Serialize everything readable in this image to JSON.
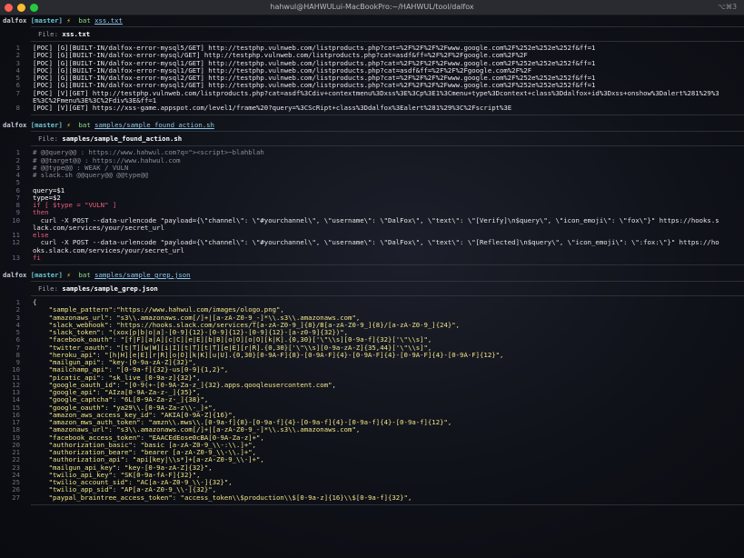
{
  "window": {
    "title": "hahwul@HAHWULui-MacBookPro:~/HAHWUL/tool/dalfox",
    "shortcut": "⌥⌘3"
  },
  "prompt": {
    "host": "dalfox",
    "branch": "[master]",
    "bolt": "⚡"
  },
  "labels": {
    "file": "File: "
  },
  "blocks": [
    {
      "cmd": "bat",
      "arg": "xss.txt",
      "file": "xss.txt",
      "lines": [
        {
          "n": "1",
          "t": "[POC] [G][BUILT-IN/dalfox-error-mysql5/GET] http://testphp.vulnweb.com/listproducts.php?cat=%2F%2F%2F%2Fwww.google.com%2F%252e%252e%252f&ff=1"
        },
        {
          "n": "2",
          "t": "[POC] [G][BUILT-IN/dalfox-error-mysql/GET] http://testphp.vulnweb.com/listproducts.php?cat=asdf&ff=%2F%2F%2Fgoogle.com%2F%2F"
        },
        {
          "n": "3",
          "t": "[POC] [G][BUILT-IN/dalfox-error-mysql1/GET] http://testphp.vulnweb.com/listproducts.php?cat=%2F%2F%2F%2Fwww.google.com%2F%252e%252e%252f&ff=1"
        },
        {
          "n": "4",
          "t": "[POC] [G][BUILT-IN/dalfox-error-mysql1/GET] http://testphp.vulnweb.com/listproducts.php?cat=asdf&ff=%2F%2F%2Fgoogle.com%2F%2F"
        },
        {
          "n": "5",
          "t": "[POC] [G][BUILT-IN/dalfox-error-mysql2/GET] http://testphp.vulnweb.com/listproducts.php?cat=%2F%2F%2F%2Fwww.google.com%2F%252e%252e%252f&ff=1"
        },
        {
          "n": "6",
          "t": "[POC] [G][BUILT-IN/dalfox-error-mysql1/GET] http://testphp.vulnweb.com/listproducts.php?cat=%2F%2F%2F%2Fwww.google.com%2F%252e%252e%252f&ff=1"
        },
        {
          "n": "7",
          "t": "[POC] [V][GET] http://testphp.vulnweb.com/listproducts.php?cat=asdf%3Cdiv+contextmenu%3Dxss%3E%3Cp%3E1%3Cmenu+type%3Dcontext+class%3Ddalfox+id%3Dxss+onshow%3Dalert%281%29%3"
        },
        {
          "n": "",
          "t": "E%3C%2Fmenu%3E%3C%2Fdiv%3E&ff=1"
        },
        {
          "n": "8",
          "t": "[POC] [V][GET] https://xss-game.appspot.com/level1/frame%20?query=%3CScRipt+class%3Ddalfox%3Ealert%281%29%3C%2Fscript%3E"
        }
      ]
    },
    {
      "cmd": "bat",
      "arg": "samples/sample_found_action.sh",
      "file": "samples/sample_found_action.sh",
      "lines": [
        {
          "n": "1",
          "t": "# @@query@@ : https://www.hahwul.com?q=\"><script>~blahblah",
          "c": "c-comment"
        },
        {
          "n": "2",
          "t": "# @@target@@ : https://www.hahwul.com",
          "c": "c-comment"
        },
        {
          "n": "3",
          "t": "# @@type@@ : WEAK / VULN",
          "c": "c-comment"
        },
        {
          "n": "4",
          "t": "# slack.sh @@query@@ @@type@@",
          "c": "c-comment"
        },
        {
          "n": "5",
          "t": ""
        },
        {
          "n": "6",
          "t": "query=$1",
          "c": "c-var"
        },
        {
          "n": "7",
          "t": "type=$2",
          "c": "c-var"
        },
        {
          "n": "8",
          "t": "if [ $type = \"VULN\" ]",
          "c": "c-kw"
        },
        {
          "n": "9",
          "t": "then",
          "c": "c-kw"
        },
        {
          "n": "10",
          "t": "  curl -X POST --data-urlencode \"payload={\\\"channel\\\": \\\"#yourchannel\\\", \\\"username\\\": \\\"DalFox\\\", \\\"text\\\": \\\"[Verify]\\n$query\\\", \\\"icon_emoji\\\": \\\"fox\\\"}\" https://hooks.s"
        },
        {
          "n": "",
          "t": "lack.com/services/your/secret_url"
        },
        {
          "n": "11",
          "t": "else",
          "c": "c-kw"
        },
        {
          "n": "12",
          "t": "  curl -X POST --data-urlencode \"payload={\\\"channel\\\": \\\"#yourchannel\\\", \\\"username\\\": \\\"DalFox\\\", \\\"text\\\": \\\"[Reflected]\\n$query\\\", \\\"icon_emoji\\\": \\\":fox:\\\"}\" https://ho"
        },
        {
          "n": "",
          "t": "oks.slack.com/services/your/secret_url"
        },
        {
          "n": "13",
          "t": "fi",
          "c": "c-kw"
        }
      ]
    },
    {
      "cmd": "bat",
      "arg": "samples/sample_grep.json",
      "file": "samples/sample_grep.json",
      "lines": [
        {
          "n": "1",
          "t": "{"
        },
        {
          "n": "2",
          "t": "    \"sample_pattern\":\"https://www.hahwul.com/images/ologo.png\",",
          "c": "c-key"
        },
        {
          "n": "3",
          "t": "    \"amazonaws_url\": \"s3\\\\.amazonaws.com[/]+|[a-zA-Z0-9_-]*\\\\.s3\\\\.amazonaws.com\",",
          "c": "c-key"
        },
        {
          "n": "4",
          "t": "    \"slack_webhook\": \"https://hooks.slack.com/services/T[a-zA-Z0-9_]{8}/B[a-zA-Z0-9_]{8}/[a-zA-Z0-9_]{24}\",",
          "c": "c-key"
        },
        {
          "n": "5",
          "t": "    \"slack_token\": \"(xox[p|b|o|a]-[0-9]{12}-[0-9]{12}-[0-9]{12}-[a-z0-9]{32})\",",
          "c": "c-key"
        },
        {
          "n": "6",
          "t": "    \"facebook_oauth\": \"[f|F][a|A][c|C][e|E][b|B][o|O][o|O][k|K].{0,30}['\\\"\\\\s][0-9a-f]{32}['\\\"\\\\s]\",",
          "c": "c-key"
        },
        {
          "n": "7",
          "t": "    \"twitter_oauth\": \"[t|T][w|W][i|I][t|T][t|T][e|E][r|R].{0,30}['\\\"\\\\s][0-9a-zA-Z]{35,44}['\\\"\\\\s]\",",
          "c": "c-key"
        },
        {
          "n": "8",
          "t": "    \"heroku_api\": \"[h|H][e|E][r|R][o|O][k|K][u|U].{0,30}[0-9A-F]{8}-[0-9A-F]{4}-[0-9A-F]{4}-[0-9A-F]{4}-[0-9A-F]{12}\",",
          "c": "c-key"
        },
        {
          "n": "9",
          "t": "    \"mailgun_api\": \"key-[0-9a-zA-Z]{32}\",",
          "c": "c-key"
        },
        {
          "n": "10",
          "t": "    \"mailchamp_api\": \"[0-9a-f]{32}-us[0-9]{1,2}\",",
          "c": "c-key"
        },
        {
          "n": "11",
          "t": "    \"picatic_api\": \"sk_live_[0-9a-z]{32}\",",
          "c": "c-key"
        },
        {
          "n": "12",
          "t": "    \"google_oauth_id\": \"[0-9(+-[0-9A-Za-z_]{32}.apps.qooqleusercontent.com\",",
          "c": "c-key"
        },
        {
          "n": "13",
          "t": "    \"google_api\": \"AIza[0-9A-Za-z-_]{35}\",",
          "c": "c-key"
        },
        {
          "n": "14",
          "t": "    \"google_captcha\": \"6L[0-9A-Za-z-_]{38}\",",
          "c": "c-key"
        },
        {
          "n": "15",
          "t": "    \"google_oauth\": \"ya29\\\\.[0-9A-Za-z\\\\-_]+\",",
          "c": "c-key"
        },
        {
          "n": "16",
          "t": "    \"amazon_aws_access_key_id\": \"AKIA[0-9A-Z]{16}\",",
          "c": "c-key"
        },
        {
          "n": "17",
          "t": "    \"amazon_mws_auth_token\": \"amzn\\\\.mws\\\\.[0-9a-f]{8}-[0-9a-f]{4}-[0-9a-f]{4}-[0-9a-f]{4}-[0-9a-f]{12}\",",
          "c": "c-key"
        },
        {
          "n": "18",
          "t": "    \"amazonaws_url\": \"s3\\\\.amazonaws.com[/]+|[a-zA-Z0-9_-]*\\\\.s3\\\\.amazonaws.com\",",
          "c": "c-key"
        },
        {
          "n": "19",
          "t": "    \"facebook_access_token\": \"EAACEdEose0cBA[0-9A-Za-z]+\",",
          "c": "c-key"
        },
        {
          "n": "20",
          "t": "    \"authorization_basic\": \"basic [a-zA-Z0-9_\\\\-:\\\\.]+\",",
          "c": "c-key"
        },
        {
          "n": "21",
          "t": "    \"authorization_beare\": \"bearer [a-zA-Z0-9_\\\\-\\\\.]+\",",
          "c": "c-key"
        },
        {
          "n": "22",
          "t": "    \"authorization_api\": \"api[key|\\\\s*]+[a-zA-Z0-9_\\\\-]+\",",
          "c": "c-key"
        },
        {
          "n": "23",
          "t": "    \"mailgun_api_key\": \"key-[0-9a-zA-Z]{32}\",",
          "c": "c-key"
        },
        {
          "n": "24",
          "t": "    \"twilio_api_key\": \"SK[0-9a-fA-F]{32}\",",
          "c": "c-key"
        },
        {
          "n": "25",
          "t": "    \"twilio_account_sid\": \"AC[a-zA-Z0-9_\\\\-]{32}\",",
          "c": "c-key"
        },
        {
          "n": "26",
          "t": "    \"twilio_app_sid\": \"AP[a-zA-Z0-9_\\\\-]{32}\",",
          "c": "c-key"
        },
        {
          "n": "27",
          "t": "    \"paypal_braintree_access_token\": \"access_token\\\\$production\\\\$[0-9a-z]{16}\\\\$[0-9a-f]{32}\",",
          "c": "c-key"
        }
      ]
    }
  ]
}
